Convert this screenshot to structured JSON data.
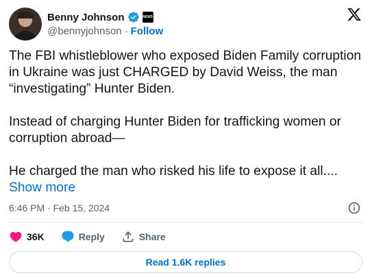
{
  "author": {
    "name": "Benny Johnson",
    "handle": "@bennyjohnson",
    "separator": "·",
    "follow_label": "Follow",
    "avatar_icon": "user-avatar",
    "affiliation_badge_text": "NEWS",
    "verified_color": "#1d9bf0"
  },
  "tweet": {
    "paragraph1": "The FBI whistleblower who exposed Biden Family corruption in Ukraine was just CHARGED by David Weiss, the man “investigating” Hunter Biden.",
    "paragraph2": "Instead of charging Hunter Biden for trafficking women or corruption abroad—",
    "paragraph3": "He charged the man who risked his life to expose it all....",
    "show_more_label": "Show more",
    "timestamp": "6:46 PM · Feb 15, 2024"
  },
  "actions": {
    "likes_count": "36K",
    "reply_label": "Reply",
    "share_label": "Share",
    "like_color": "#f91880",
    "reply_color": "#1d9bf0"
  },
  "footer": {
    "read_replies_label": "Read 1.6K replies"
  },
  "colors": {
    "link": "#006fd6",
    "text": "#0f1419",
    "secondary": "#536471",
    "border": "#cfd9de"
  }
}
